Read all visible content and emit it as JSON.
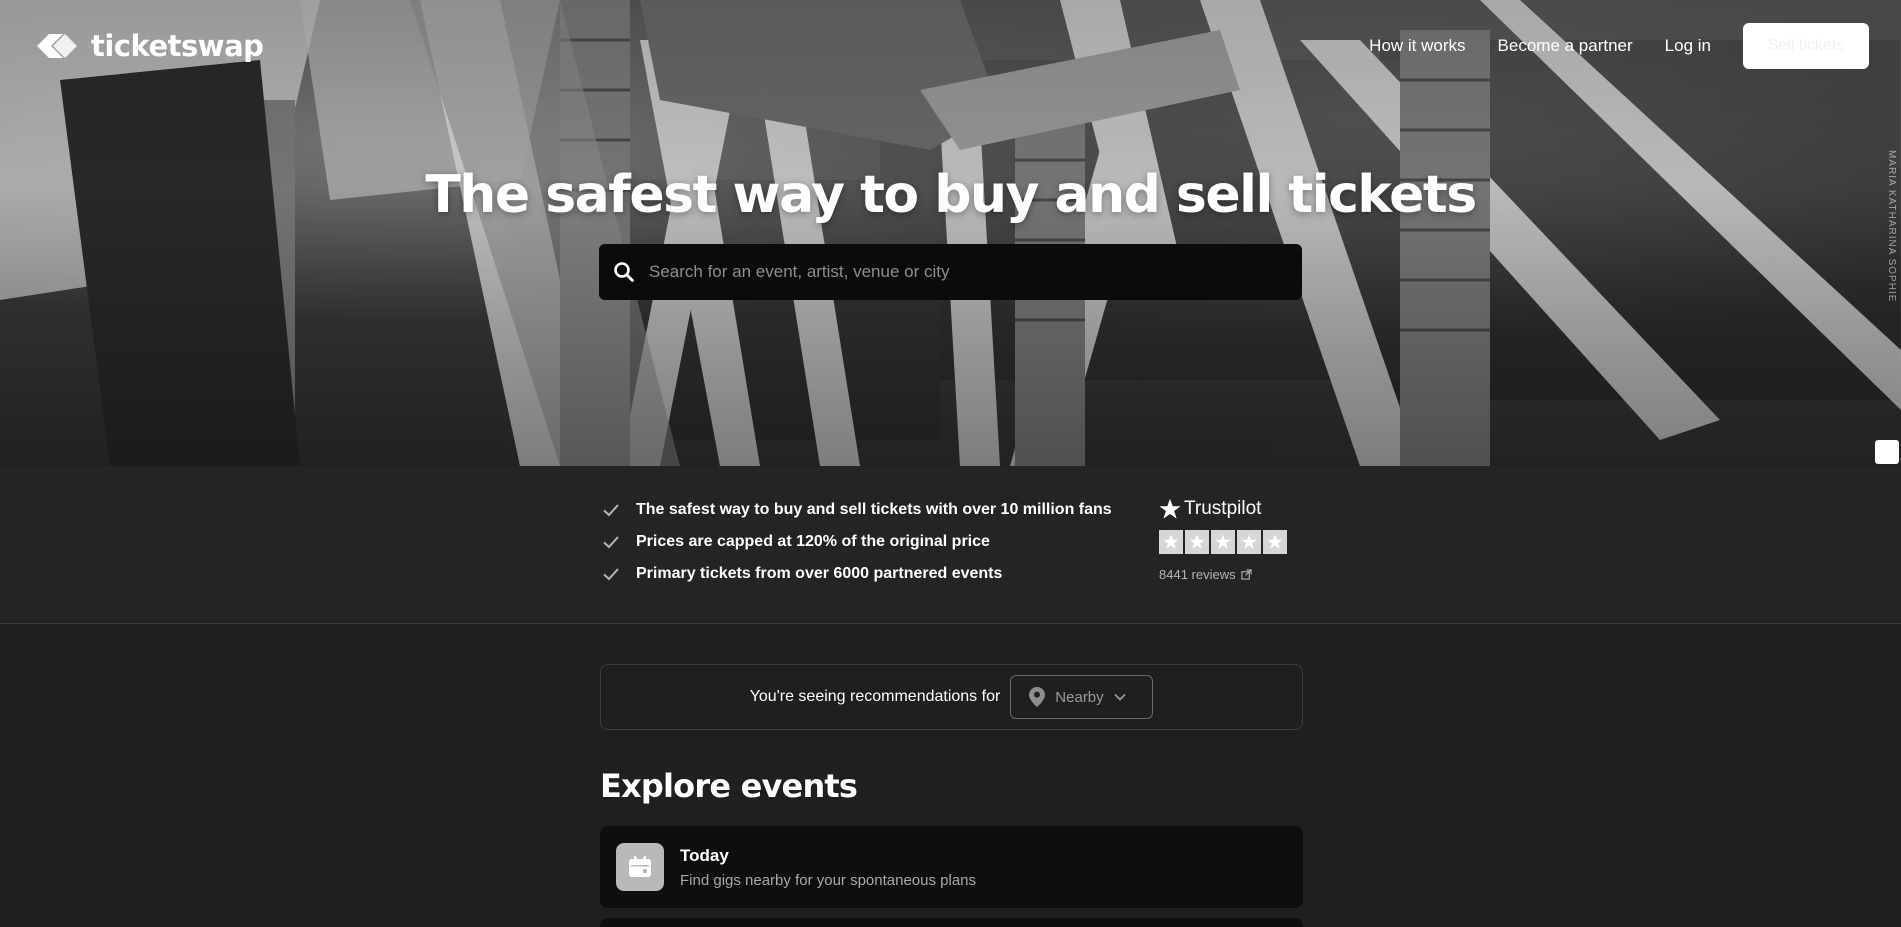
{
  "header": {
    "brand": "ticketswap",
    "nav": {
      "how_it_works": "How it works",
      "become_partner": "Become a partner",
      "log_in": "Log in",
      "sell_tickets": "Sell tickets"
    }
  },
  "hero": {
    "title": "The safest way to buy and sell tickets",
    "search_placeholder": "Search for an event, artist, venue or city",
    "photo_credit": "MARIA KATHARINA SOPHIE"
  },
  "usps": [
    "The safest way to buy and sell tickets with over 10 million fans",
    "Prices are capped at 120% of the original price",
    "Primary tickets from over 6000 partnered events"
  ],
  "trustpilot": {
    "brand": "Trustpilot",
    "stars": 5,
    "reviews": "8441 reviews"
  },
  "recommendations": {
    "label": "You're seeing recommendations for",
    "location": "Nearby"
  },
  "explore": {
    "title": "Explore events",
    "cards": [
      {
        "title": "Today",
        "subtitle": "Find gigs nearby for your spontaneous plans",
        "icon": "calendar-icon"
      }
    ]
  },
  "colors": {
    "page_bg": "#1f1f1f",
    "usp_bg": "#242424",
    "search_bg": "#0b0b0b",
    "card_bg": "#0e0e0e"
  }
}
